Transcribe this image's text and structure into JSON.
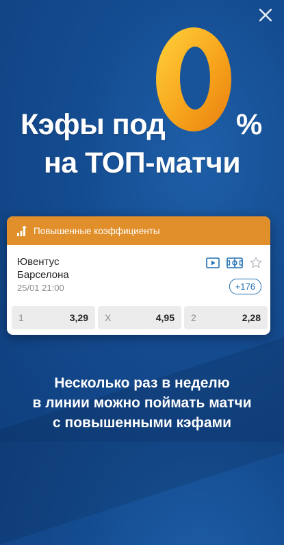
{
  "promo": {
    "headline_line1": "Кэфы под",
    "headline_zero": "0",
    "headline_percent": "%",
    "headline_line2": "на ТОП-матчи",
    "subtext": [
      "Несколько раз в неделю",
      "в линии можно поймать матчи",
      "с повышенными кэфами"
    ]
  },
  "card": {
    "header": "Повышенные коэффициенты",
    "team1": "Ювентус",
    "team2": "Барселона",
    "datetime": "25/01 21:00",
    "more_markets": "+176",
    "icons": [
      "play-video-icon",
      "stats-field-icon",
      "favorite-star-icon"
    ],
    "odds": [
      {
        "label": "1",
        "value": "3,29"
      },
      {
        "label": "X",
        "value": "4,95"
      },
      {
        "label": "2",
        "value": "2,28"
      }
    ]
  },
  "colors": {
    "background": "#154d92",
    "card_header": "#e08f2b",
    "accent_blue": "#1f6fb4",
    "zero_orange": "#f5a21b"
  }
}
